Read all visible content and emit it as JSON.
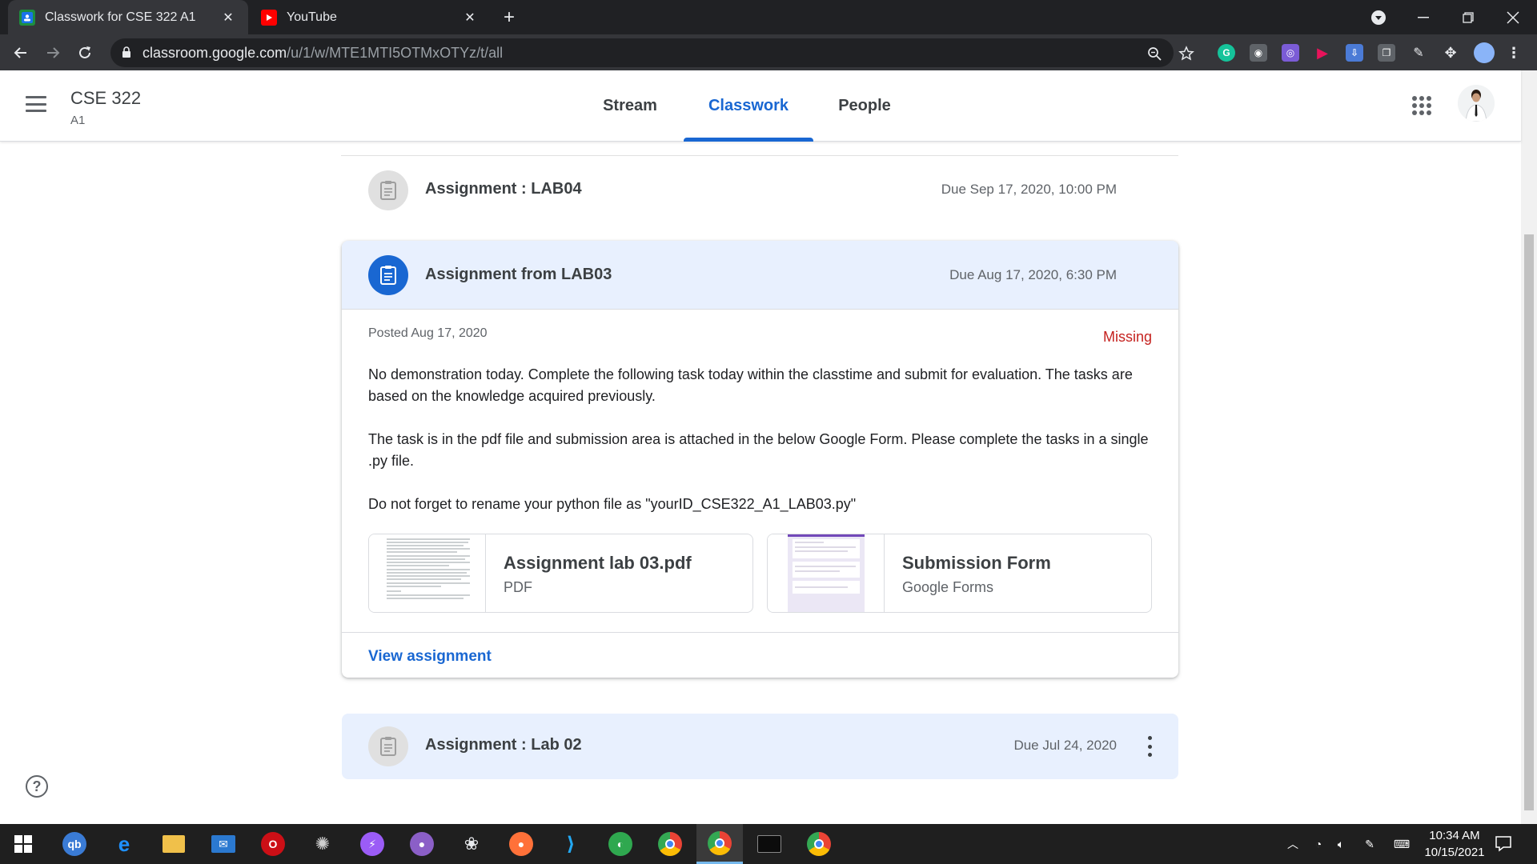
{
  "browser": {
    "tabs": [
      {
        "title": "Classwork for CSE 322 A1",
        "favicon": "google-classroom-icon",
        "active": true
      },
      {
        "title": "YouTube",
        "favicon": "youtube-icon",
        "active": false
      }
    ],
    "url_host": "classroom.google.com",
    "url_path": "/u/1/w/MTE1MTI5OTMxOTYz/t/all"
  },
  "classroom": {
    "class_name": "CSE 322",
    "section": "A1",
    "tabs": [
      {
        "label": "Stream",
        "active": false
      },
      {
        "label": "Classwork",
        "active": true
      },
      {
        "label": "People",
        "active": false
      }
    ]
  },
  "assignments": {
    "lab04": {
      "title": "Assignment : LAB04",
      "due": "Due Sep 17, 2020, 10:00 PM"
    },
    "lab03": {
      "title": "Assignment from LAB03",
      "due": "Due Aug 17, 2020, 6:30 PM",
      "posted": "Posted Aug 17, 2020",
      "status": "Missing",
      "description": [
        "No demonstration today. Complete the following task today within the classtime and submit for evaluation. The tasks are based on the knowledge acquired previously.",
        "The task is in the pdf file and submission area is attached in the below Google Form. Please complete the tasks in a single .py file.",
        "Do not forget to rename your python file as \"yourID_CSE322_A1_LAB03.py\""
      ],
      "attachments": [
        {
          "title": "Assignment lab 03.pdf",
          "type": "PDF"
        },
        {
          "title": "Submission Form",
          "type": "Google Forms"
        }
      ],
      "view_link": "View assignment"
    },
    "lab02": {
      "title": "Assignment : Lab 02",
      "due": "Due Jul 24, 2020"
    }
  },
  "taskbar": {
    "time": "10:34 AM",
    "date": "10/15/2021"
  },
  "colors": {
    "accent": "#1967d2",
    "missing": "#c5221f",
    "highlight_bg": "#e8f0fe"
  }
}
